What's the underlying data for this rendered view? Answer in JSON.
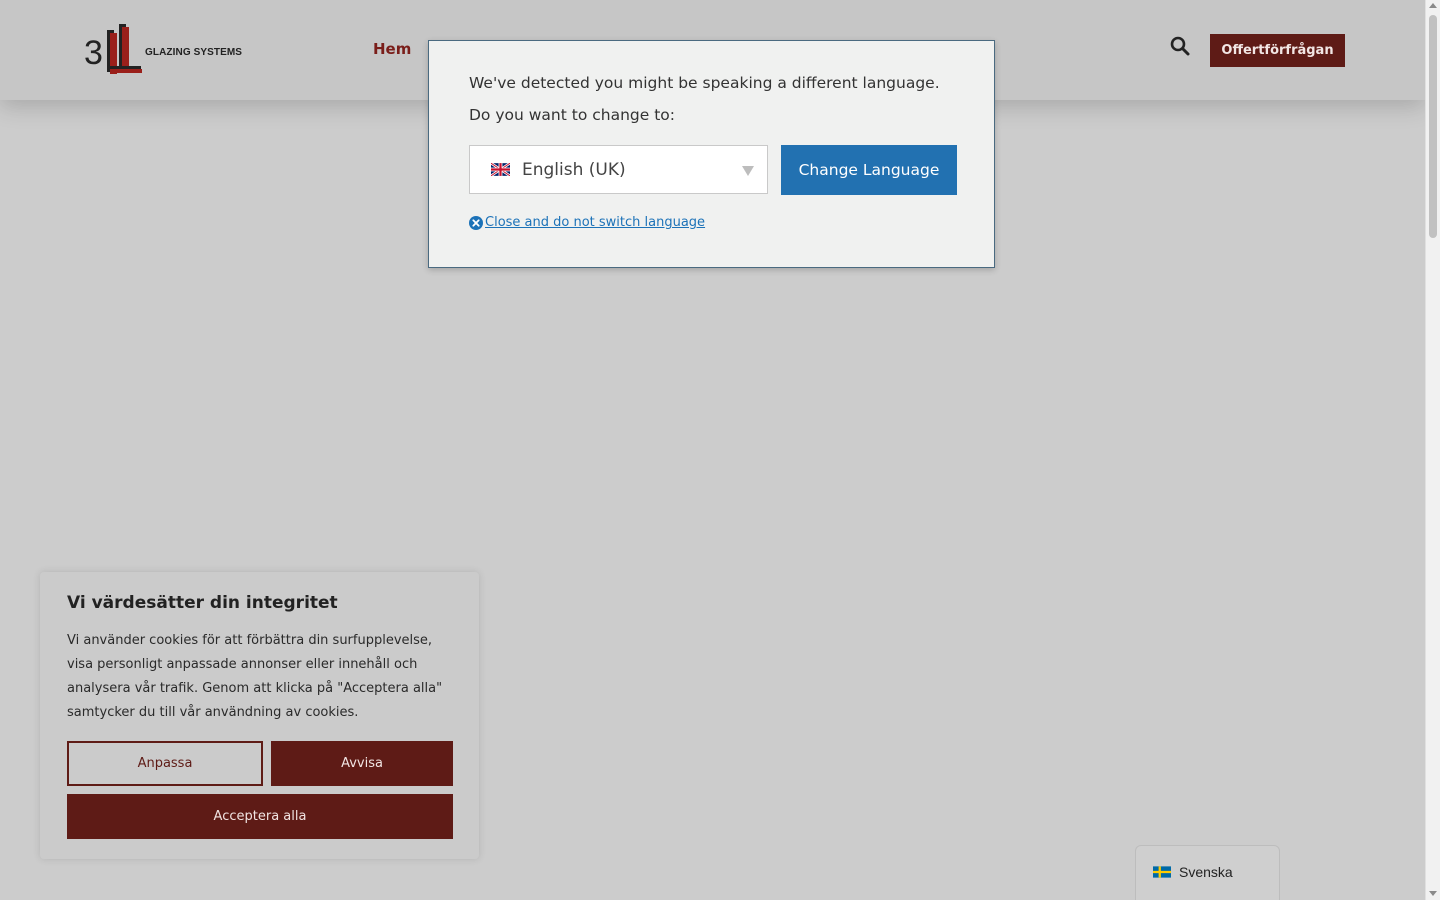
{
  "header": {
    "logo_number": "3",
    "logo_brand": "GLAZING SYSTEMS",
    "nav_home": "Hem",
    "quote_button": "Offertförfrågan",
    "search_icon": "search-icon"
  },
  "language_modal": {
    "message": "We've detected you might be speaking a different language. Do you want to change to:",
    "selected_language": "English (UK)",
    "change_button": "Change Language",
    "close_link": "Close and do not switch language",
    "button_color": "#2271b1"
  },
  "cookie_banner": {
    "title": "Vi värdesätter din integritet",
    "text": "Vi använder cookies för att förbättra din surfupplevelse, visa personligt anpassade annonser eller innehåll och analysera vår trafik. Genom att klicka på \"Acceptera alla\" samtycker du till vår användning av cookies.",
    "customize_button": "Anpassa",
    "reject_button": "Avvisa",
    "accept_button": "Acceptera alla",
    "button_color": "#5e1b16"
  },
  "language_switcher": {
    "label": "Svenska"
  }
}
